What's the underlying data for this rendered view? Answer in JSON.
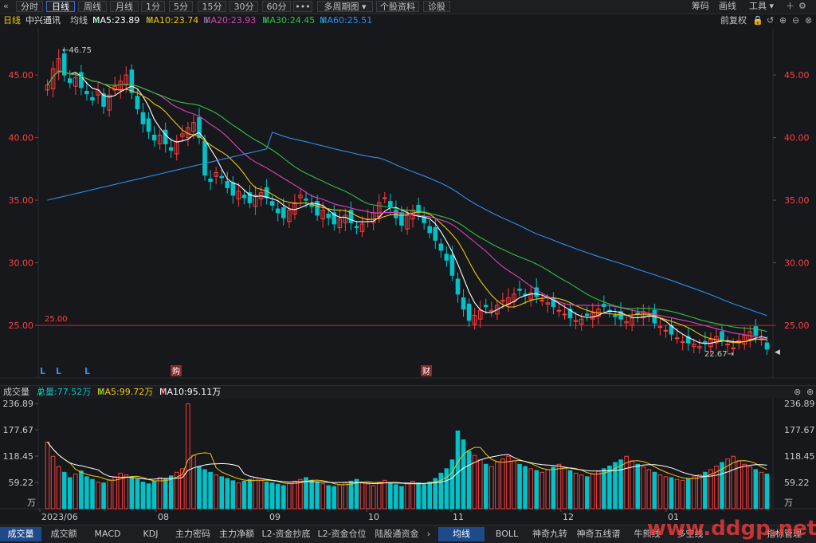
{
  "toolbar": {
    "left_icon": "double-chevron-left-icon",
    "tabs": [
      "分时",
      "日线",
      "周线",
      "月线",
      "1分",
      "5分",
      "15分",
      "30分",
      "60分",
      "•••",
      "多周期图",
      "个股资料",
      "诊股"
    ],
    "active_tab": "日线",
    "right": [
      "筹码",
      "画线",
      "工具"
    ]
  },
  "ma_bar": {
    "period": "日线",
    "name": "中兴通讯",
    "mode": "均线",
    "ma5": "MA5:23.89",
    "ma10": "MA10:23.74",
    "ma20": "MA20:23.93",
    "ma30": "MA30:24.45",
    "ma60": "MA60:25.51",
    "adjust": "前复权"
  },
  "price_axis": {
    "ticks": [
      "45.00",
      "40.00",
      "35.00",
      "30.00",
      "25.00"
    ],
    "values": [
      45,
      40,
      35,
      30,
      25
    ],
    "min": 20.8,
    "max": 48.7
  },
  "annotations": {
    "high": "46.75",
    "low": "22.67",
    "line_25": "25.00",
    "markers": [
      "L",
      "L",
      "L"
    ],
    "event_1": "购",
    "event_2": "财"
  },
  "volume_bar": {
    "label": "成交量",
    "total": "总量:77.52万",
    "ma5": "MA5:99.72万",
    "ma10": "MA10:95.11万"
  },
  "volume_axis": {
    "ticks": [
      "236.89",
      "177.67",
      "118.45",
      "59.22"
    ],
    "values": [
      236.89,
      177.67,
      118.45,
      59.22
    ],
    "unit": "万",
    "max": 236.89
  },
  "date_axis": [
    "2023/06",
    "08",
    "09",
    "10",
    "11",
    "12",
    "01"
  ],
  "bottom_tabs": [
    "成交量",
    "成交额",
    "MACD",
    "KDJ",
    "主力密码",
    "主力净额",
    "L2-资金抄底",
    "L2-资金仓位",
    "陆股通资金"
  ],
  "bottom_right_tabs": [
    "均线",
    "BOLL",
    "神奇九转",
    "神奇五线谱",
    "牛熊线",
    "多空线",
    "指标管理"
  ],
  "watermark": "www.ddgp.net",
  "colors": {
    "up": "#ff3b3b",
    "down": "#00c2c9",
    "ma5": "#ffffff",
    "ma10": "#f0c808",
    "ma20": "#e040c0",
    "ma30": "#30c040",
    "ma60": "#2e8ef0"
  },
  "chart_data": {
    "type": "candlestick",
    "title": "中兴通讯 日线",
    "x": [
      "2023/06",
      "08",
      "09",
      "10",
      "11",
      "12",
      "01"
    ],
    "ylim": [
      20.8,
      48.7
    ],
    "series": [
      {
        "name": "MA5",
        "value_end": 23.89
      },
      {
        "name": "MA10",
        "value_end": 23.74
      },
      {
        "name": "MA20",
        "value_end": 23.93
      },
      {
        "name": "MA30",
        "value_end": 24.45
      },
      {
        "name": "MA60",
        "value_end": 25.51
      }
    ],
    "close": [
      44.2,
      45.5,
      46.3,
      45.0,
      44.4,
      44.8,
      44.0,
      43.5,
      43.0,
      43.8,
      42.5,
      43.4,
      44.1,
      44.5,
      45.0,
      43.6,
      42.3,
      41.1,
      40.5,
      39.8,
      40.2,
      39.5,
      39.0,
      39.7,
      40.3,
      40.8,
      41.2,
      40.0,
      37.0,
      36.5,
      37.2,
      36.8,
      36.0,
      35.4,
      35.7,
      35.2,
      34.8,
      35.4,
      35.6,
      35.2,
      34.6,
      34.0,
      33.6,
      34.2,
      34.8,
      35.4,
      35.0,
      34.5,
      33.8,
      34.2,
      33.6,
      33.1,
      33.5,
      33.8,
      33.2,
      32.8,
      33.1,
      33.5,
      34.0,
      34.8,
      35.2,
      34.5,
      33.6,
      33.0,
      33.8,
      34.2,
      34.0,
      33.2,
      32.4,
      31.8,
      31.0,
      30.2,
      29.0,
      27.5,
      26.3,
      25.4,
      25.8,
      26.2,
      26.5,
      26.2,
      26.6,
      27.0,
      27.2,
      27.5,
      27.8,
      27.4,
      27.6,
      27.3,
      27.0,
      26.8,
      26.5,
      26.2,
      25.9,
      25.6,
      25.4,
      25.5,
      25.8,
      26.0,
      26.3,
      26.5,
      26.1,
      25.7,
      25.5,
      25.3,
      25.6,
      25.9,
      26.1,
      25.8,
      25.2,
      24.9,
      24.6,
      24.3,
      24.0,
      23.7,
      23.6,
      23.5,
      23.3,
      23.6,
      23.9,
      24.1,
      23.8,
      23.5,
      23.2,
      23.8,
      24.2,
      24.5,
      24.2,
      23.9,
      23.1
    ],
    "volume": [
      150,
      118,
      95,
      82,
      70,
      78,
      85,
      72,
      66,
      60,
      58,
      65,
      72,
      80,
      76,
      70,
      66,
      60,
      56,
      62,
      70,
      68,
      74,
      82,
      90,
      236,
      120,
      95,
      88,
      82,
      76,
      72,
      68,
      63,
      58,
      62,
      66,
      70,
      64,
      60,
      58,
      55,
      52,
      57,
      62,
      66,
      70,
      64,
      60,
      56,
      52,
      50,
      54,
      58,
      62,
      66,
      60,
      56,
      52,
      60,
      64,
      58,
      54,
      50,
      56,
      62,
      58,
      54,
      60,
      68,
      80,
      90,
      110,
      175,
      155,
      130,
      120,
      110,
      100,
      95,
      105,
      112,
      118,
      108,
      100,
      95,
      90,
      86,
      82,
      88,
      94,
      100,
      92,
      86,
      80,
      76,
      72,
      78,
      84,
      90,
      96,
      104,
      110,
      118,
      108,
      100,
      94,
      88,
      82,
      76,
      72,
      70,
      66,
      64,
      68,
      72,
      76,
      82,
      88,
      96,
      104,
      112,
      118,
      108,
      100,
      94,
      88,
      82,
      78
    ]
  }
}
